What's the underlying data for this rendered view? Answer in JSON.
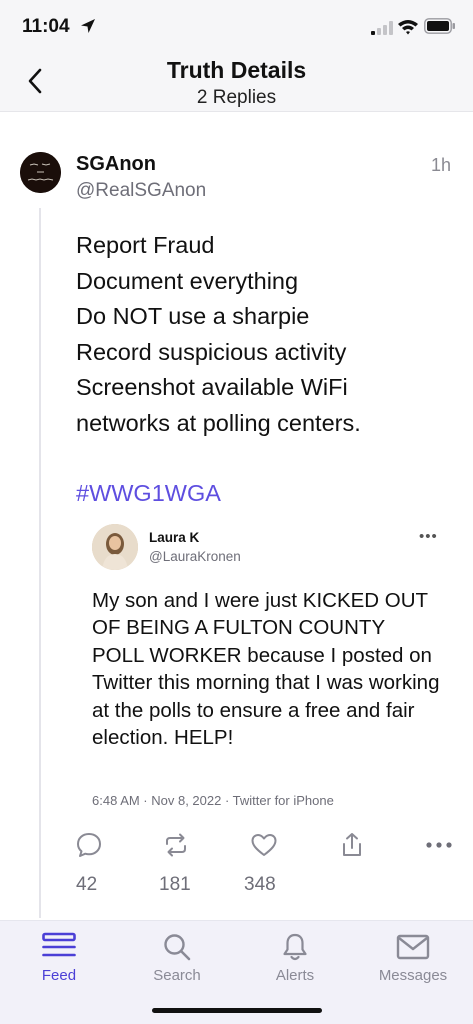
{
  "status_bar": {
    "time": "11:04"
  },
  "header": {
    "title": "Truth Details",
    "subtitle": "2 Replies"
  },
  "post": {
    "author_name": "SGAnon",
    "author_handle": "@RealSGAnon",
    "time_ago": "1h",
    "lines": [
      "Report Fraud",
      "Document everything",
      "Do NOT use a sharpie",
      "Record suspicious activity",
      "Screenshot available WiFi",
      "networks at polling centers."
    ],
    "hashtag": "#WWG1WGA",
    "embedded_tweet": {
      "author_name": "Laura K",
      "author_handle": "@LauraKronen",
      "more": "•••",
      "text": "My son and I were just KICKED OUT OF BEING A FULTON COUNTY POLL WORKER because I posted on Twitter this morning that I was working at the polls to ensure a free and fair election. HELP!",
      "meta": "6:48 AM · Nov 8, 2022 · Twitter for iPhone"
    },
    "actions": {
      "replies": "42",
      "retruths": "181",
      "likes": "348"
    }
  },
  "tab_bar": {
    "items": [
      {
        "label": "Feed",
        "icon": "feed-icon",
        "active": true
      },
      {
        "label": "Search",
        "icon": "search-icon",
        "active": false
      },
      {
        "label": "Alerts",
        "icon": "bell-icon",
        "active": false
      },
      {
        "label": "Messages",
        "icon": "mail-icon",
        "active": false
      }
    ]
  },
  "colors": {
    "accent": "#4b3fd6",
    "hashtag": "#5e4ee0",
    "muted": "#6e6e78"
  }
}
